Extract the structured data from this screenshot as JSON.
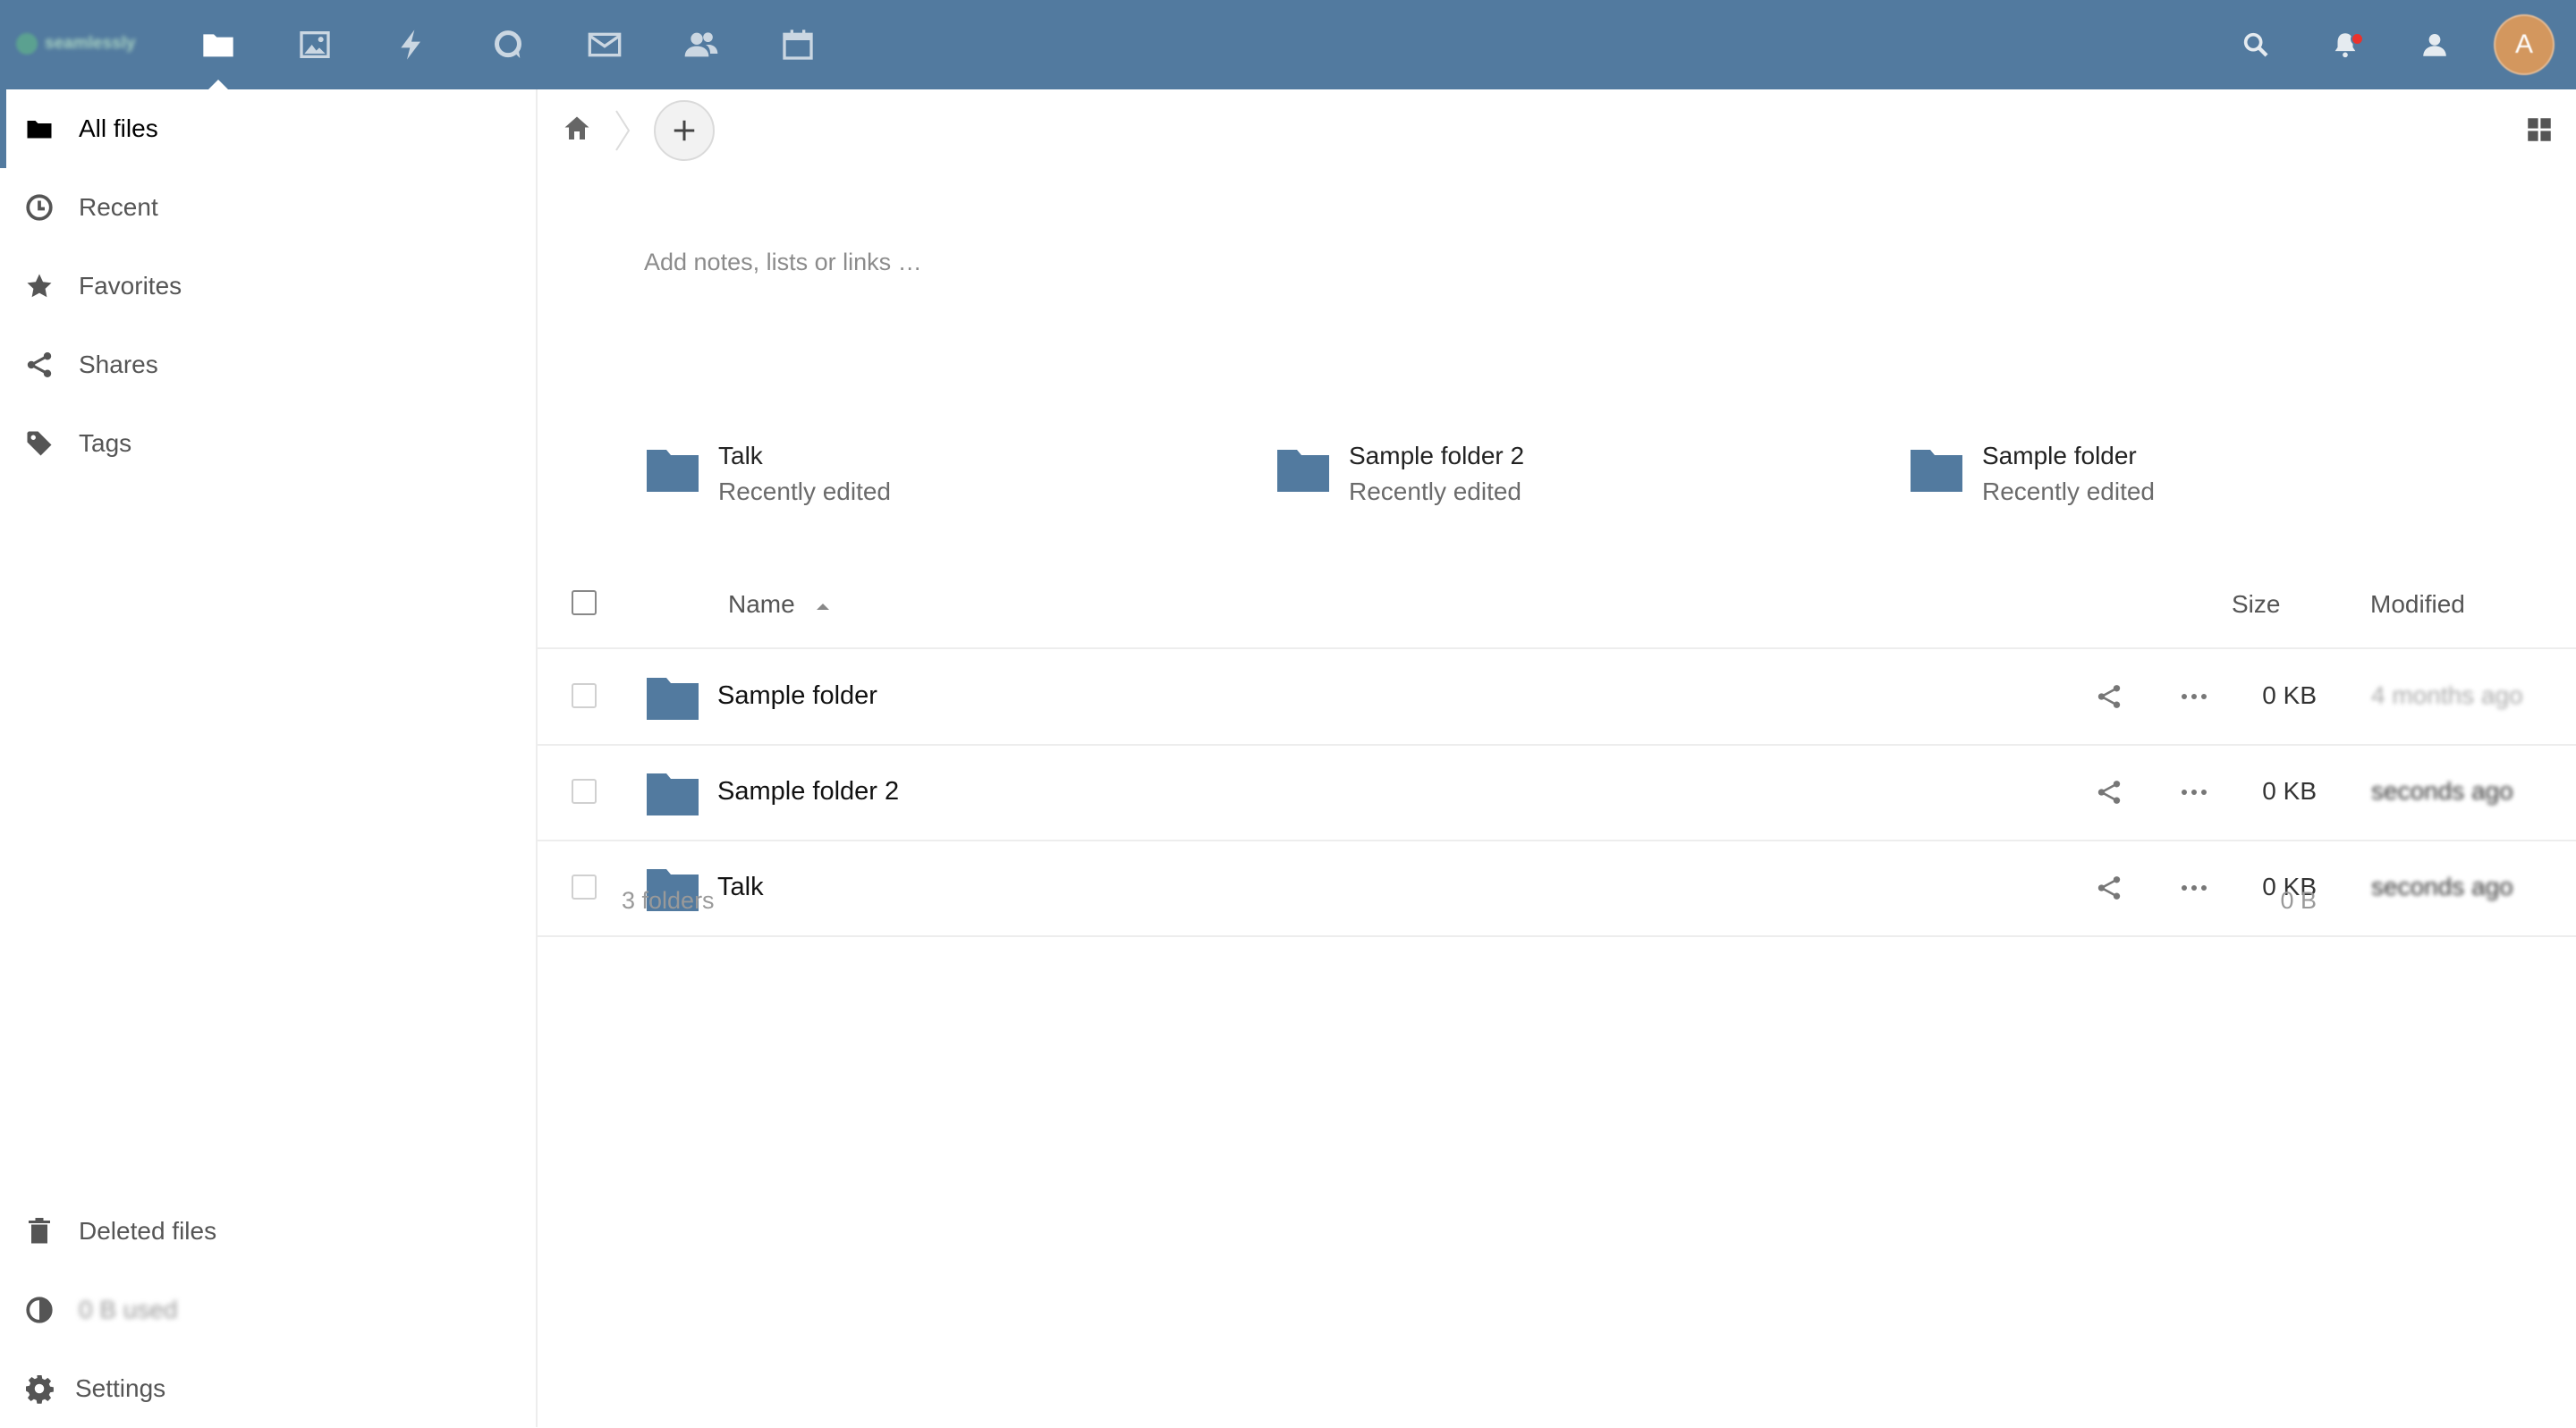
{
  "brand": {
    "logo_text": "seamlessly"
  },
  "colors": {
    "header": "#527a9f",
    "folder": "#527a9f",
    "avatar": "#d3975e",
    "notification": "#e9322d"
  },
  "header": {
    "apps": [
      {
        "name": "Files",
        "icon": "folder-icon",
        "active": true
      },
      {
        "name": "Photos",
        "icon": "image-icon"
      },
      {
        "name": "Activity",
        "icon": "lightning-icon"
      },
      {
        "name": "Talk",
        "icon": "chat-bubble-icon"
      },
      {
        "name": "Mail",
        "icon": "mail-icon"
      },
      {
        "name": "Contacts",
        "icon": "contacts-icon"
      },
      {
        "name": "Calendar",
        "icon": "calendar-icon"
      }
    ],
    "right": [
      "search-icon",
      "notifications-bell-icon",
      "contacts-menu-icon"
    ],
    "avatar_initial": "A"
  },
  "sidebar": {
    "items": [
      {
        "label": "All files",
        "icon": "folder-icon",
        "active": true
      },
      {
        "label": "Recent",
        "icon": "clock-icon"
      },
      {
        "label": "Favorites",
        "icon": "star-icon"
      },
      {
        "label": "Shares",
        "icon": "share-icon"
      },
      {
        "label": "Tags",
        "icon": "tag-icon"
      }
    ],
    "bottom": {
      "deleted": "Deleted files",
      "quota": "0 B used",
      "settings": "Settings"
    }
  },
  "main": {
    "notes_placeholder": "Add notes, lists or links …",
    "recent": [
      {
        "name": "Talk",
        "sub": "Recently edited"
      },
      {
        "name": "Sample folder 2",
        "sub": "Recently edited"
      },
      {
        "name": "Sample folder",
        "sub": "Recently edited"
      }
    ],
    "columns": {
      "name": "Name",
      "size": "Size",
      "modified": "Modified"
    },
    "files": [
      {
        "name": "Sample folder",
        "size": "0 KB",
        "modified": "4 months ago"
      },
      {
        "name": "Sample folder 2",
        "size": "0 KB",
        "modified": "seconds ago"
      },
      {
        "name": "Talk",
        "size": "0 KB",
        "modified": "seconds ago"
      }
    ],
    "summary": {
      "count": "3 folders",
      "size": "0 B"
    }
  }
}
